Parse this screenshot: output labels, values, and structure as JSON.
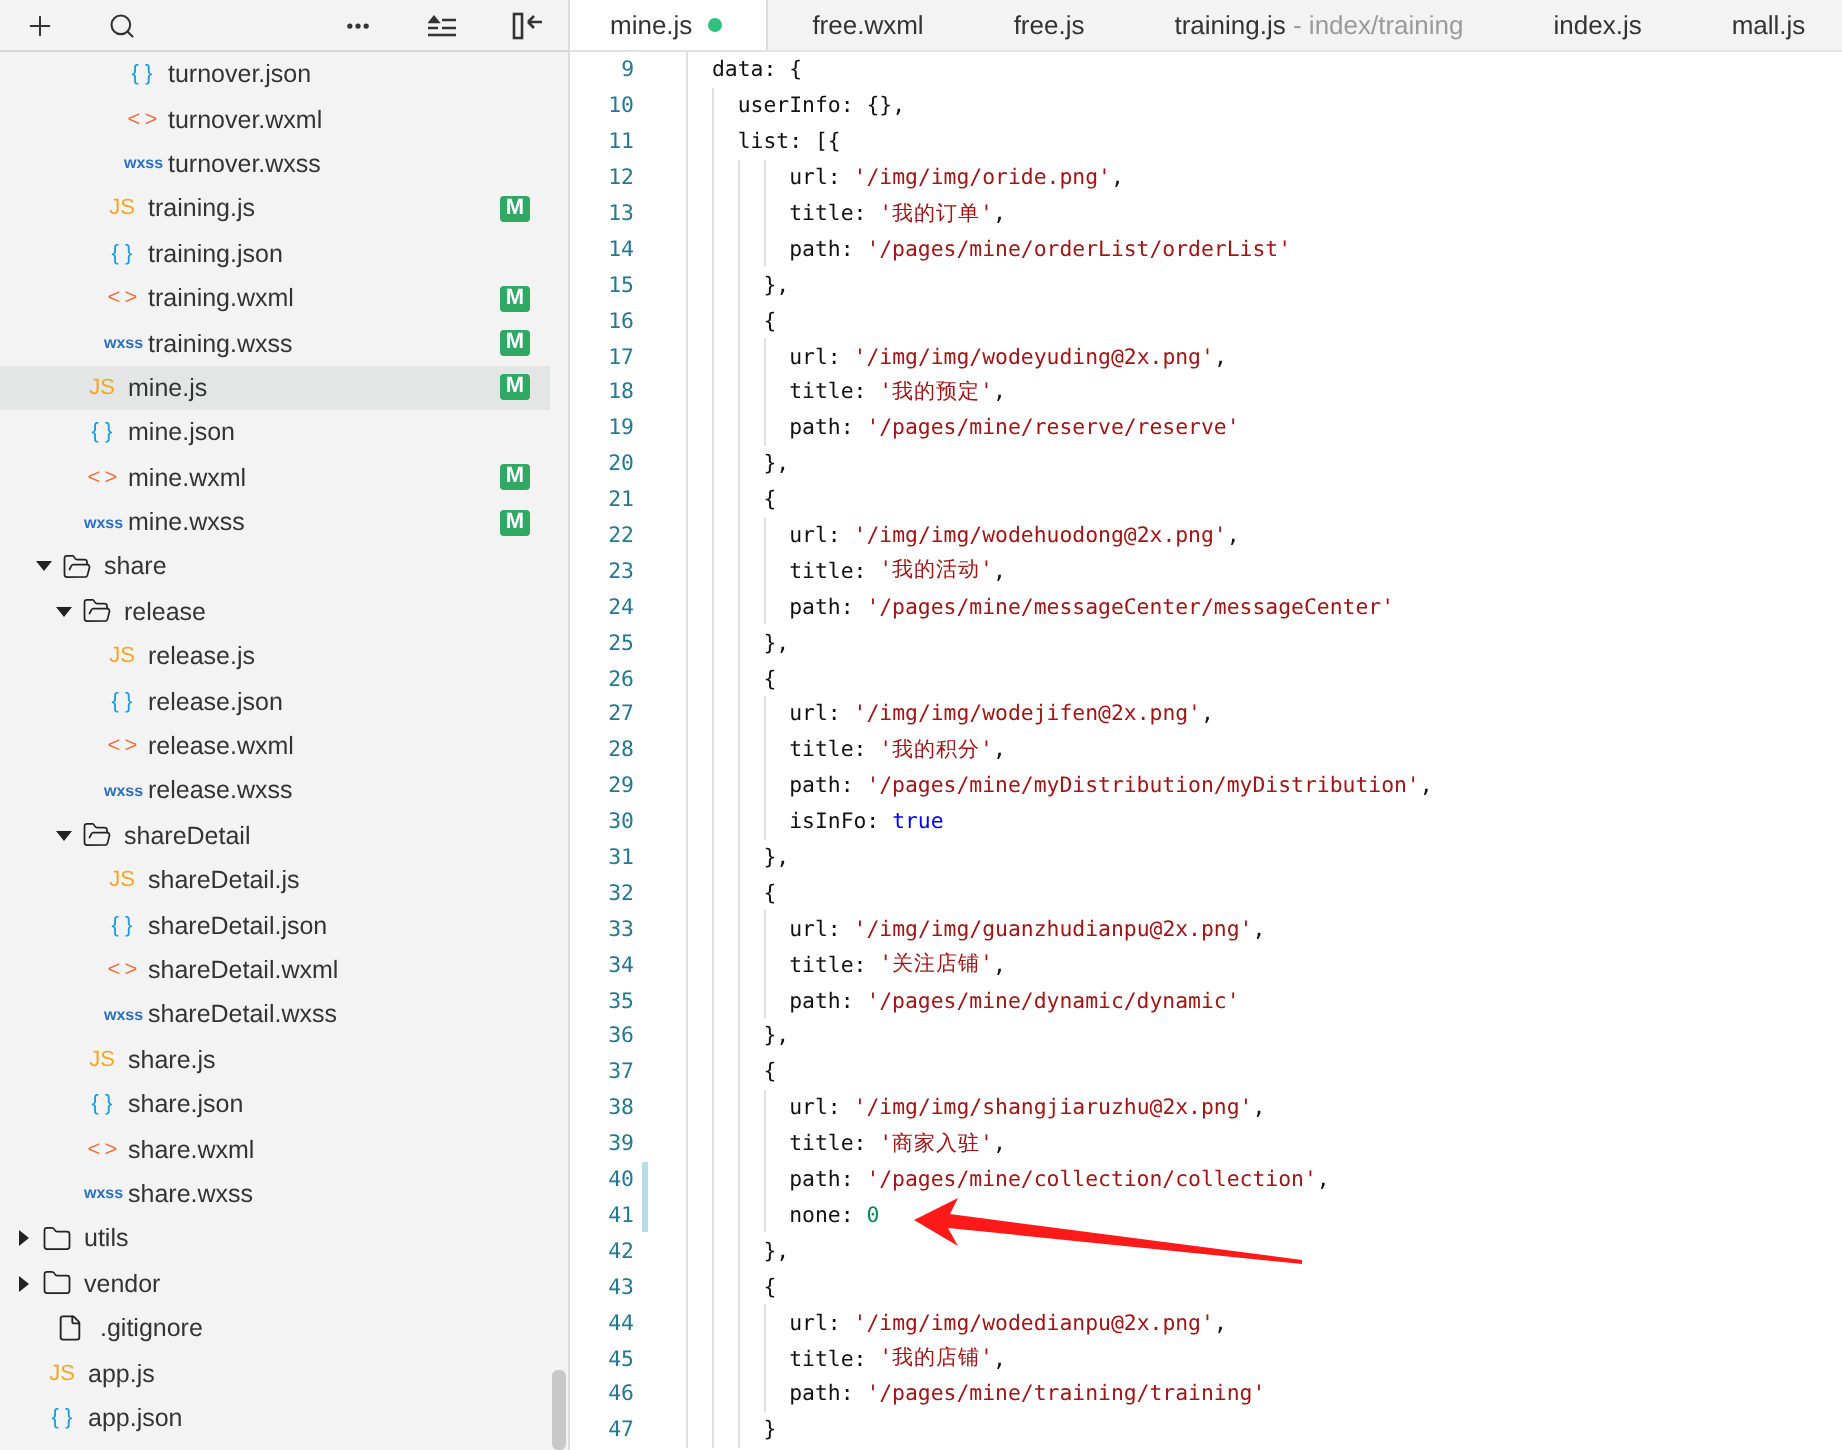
{
  "tree": [
    {
      "children": [
        {
          "children": [
            {
              "children": [
                {
                  "children": [
                    {
                      "label": "turnover.json",
                      "kind": "json",
                      "icon": "{ }",
                      "selected": false
                    },
                    {
                      "label": "turnover.wxml",
                      "kind": "wxml",
                      "icon": "< >",
                      "selected": false
                    },
                    {
                      "label": "turnover.wxss",
                      "kind": "wxss",
                      "icon": "wxss",
                      "selected": false
                    }
                  ]
                },
                {
                  "label": "training.js",
                  "kind": "js",
                  "icon": "JS",
                  "badge": "M",
                  "selected": false
                },
                {
                  "label": "training.json",
                  "kind": "json",
                  "icon": "{ }",
                  "selected": false
                },
                {
                  "label": "training.wxml",
                  "kind": "wxml",
                  "icon": "< >",
                  "badge": "M",
                  "selected": false
                },
                {
                  "label": "training.wxss",
                  "kind": "wxss",
                  "icon": "wxss",
                  "badge": "M",
                  "selected": false
                }
              ]
            },
            {
              "label": "mine.js",
              "kind": "js",
              "icon": "JS",
              "badge": "M",
              "selected": true
            },
            {
              "label": "mine.json",
              "kind": "json",
              "icon": "{ }",
              "selected": false
            },
            {
              "label": "mine.wxml",
              "kind": "wxml",
              "icon": "< >",
              "badge": "M",
              "selected": false
            },
            {
              "label": "mine.wxss",
              "kind": "wxss",
              "icon": "wxss",
              "badge": "M",
              "selected": false
            }
          ]
        },
        {
          "label": "share",
          "kind": "folder",
          "expanded": true,
          "selected": false,
          "children": [
            {
              "label": "release",
              "kind": "folder",
              "expanded": true,
              "selected": false,
              "children": [
                {
                  "label": "release.js",
                  "kind": "js",
                  "icon": "JS",
                  "selected": false
                },
                {
                  "label": "release.json",
                  "kind": "json",
                  "icon": "{ }",
                  "selected": false
                },
                {
                  "label": "release.wxml",
                  "kind": "wxml",
                  "icon": "< >",
                  "selected": false
                },
                {
                  "label": "release.wxss",
                  "kind": "wxss",
                  "icon": "wxss",
                  "selected": false
                }
              ]
            },
            {
              "label": "shareDetail",
              "kind": "folder",
              "expanded": true,
              "selected": false,
              "children": [
                {
                  "label": "shareDetail.js",
                  "kind": "js",
                  "icon": "JS",
                  "selected": false
                },
                {
                  "label": "shareDetail.json",
                  "kind": "json",
                  "icon": "{ }",
                  "selected": false
                },
                {
                  "label": "shareDetail.wxml",
                  "kind": "wxml",
                  "icon": "< >",
                  "selected": false
                },
                {
                  "label": "shareDetail.wxss",
                  "kind": "wxss",
                  "icon": "wxss",
                  "selected": false
                }
              ]
            },
            {
              "label": "share.js",
              "kind": "js",
              "icon": "JS",
              "selected": false
            },
            {
              "label": "share.json",
              "kind": "json",
              "icon": "{ }",
              "selected": false
            },
            {
              "label": "share.wxml",
              "kind": "wxml",
              "icon": "< >",
              "selected": false
            },
            {
              "label": "share.wxss",
              "kind": "wxss",
              "icon": "wxss",
              "selected": false
            }
          ]
        }
      ]
    },
    {
      "label": "utils",
      "kind": "folder",
      "expanded": false,
      "selected": false
    },
    {
      "label": "vendor",
      "kind": "folder",
      "expanded": false,
      "selected": false
    },
    {
      "label": ".gitignore",
      "kind": "file",
      "selected": false
    },
    {
      "label": "app.js",
      "kind": "js",
      "icon": "JS",
      "selected": false
    },
    {
      "label": "app.json",
      "kind": "json",
      "icon": "{ }",
      "selected": false
    }
  ],
  "tabs": [
    {
      "label": "mine.js",
      "selected": true,
      "modified": true
    },
    {
      "label": "free.wxml",
      "selected": false,
      "modified": false
    },
    {
      "label": "free.js",
      "selected": false,
      "modified": false
    },
    {
      "label": "training.js",
      "hint": "- index/training",
      "selected": false,
      "modified": false
    },
    {
      "label": "index.js",
      "selected": false,
      "modified": false
    },
    {
      "label": "mall.js",
      "selected": false,
      "modified": false
    }
  ],
  "lines": [
    {
      "n": "9",
      "changed": false,
      "parts": [
        {
          "kind": "plain",
          "text": "data: {"
        }
      ]
    },
    {
      "n": "10",
      "changed": false,
      "parts": [
        {
          "kind": "plain",
          "text": "  userInfo: {},"
        }
      ]
    },
    {
      "n": "11",
      "changed": false,
      "parts": [
        {
          "kind": "plain",
          "text": "  list: [{"
        }
      ]
    },
    {
      "n": "12",
      "changed": false,
      "parts": [
        {
          "kind": "plain",
          "text": "      url: "
        },
        {
          "kind": "string",
          "text": "'/img/img/oride.png'"
        },
        {
          "kind": "plain",
          "text": ","
        }
      ]
    },
    {
      "n": "13",
      "changed": false,
      "parts": [
        {
          "kind": "plain",
          "text": "      title: "
        },
        {
          "kind": "string",
          "text": "'我的订单'"
        },
        {
          "kind": "plain",
          "text": ","
        }
      ]
    },
    {
      "n": "14",
      "changed": false,
      "parts": [
        {
          "kind": "plain",
          "text": "      path: "
        },
        {
          "kind": "string",
          "text": "'/pages/mine/orderList/orderList'"
        }
      ]
    },
    {
      "n": "15",
      "changed": false,
      "parts": [
        {
          "kind": "plain",
          "text": "    },"
        }
      ]
    },
    {
      "n": "16",
      "changed": false,
      "parts": [
        {
          "kind": "plain",
          "text": "    {"
        }
      ]
    },
    {
      "n": "17",
      "changed": false,
      "parts": [
        {
          "kind": "plain",
          "text": "      url: "
        },
        {
          "kind": "string",
          "text": "'/img/img/wodeyuding@2x.png'"
        },
        {
          "kind": "plain",
          "text": ","
        }
      ]
    },
    {
      "n": "18",
      "changed": false,
      "parts": [
        {
          "kind": "plain",
          "text": "      title: "
        },
        {
          "kind": "string",
          "text": "'我的预定'"
        },
        {
          "kind": "plain",
          "text": ","
        }
      ]
    },
    {
      "n": "19",
      "changed": false,
      "parts": [
        {
          "kind": "plain",
          "text": "      path: "
        },
        {
          "kind": "string",
          "text": "'/pages/mine/reserve/reserve'"
        }
      ]
    },
    {
      "n": "20",
      "changed": false,
      "parts": [
        {
          "kind": "plain",
          "text": "    },"
        }
      ]
    },
    {
      "n": "21",
      "changed": false,
      "parts": [
        {
          "kind": "plain",
          "text": "    {"
        }
      ]
    },
    {
      "n": "22",
      "changed": false,
      "parts": [
        {
          "kind": "plain",
          "text": "      url: "
        },
        {
          "kind": "string",
          "text": "'/img/img/wodehuodong@2x.png'"
        },
        {
          "kind": "plain",
          "text": ","
        }
      ]
    },
    {
      "n": "23",
      "changed": false,
      "parts": [
        {
          "kind": "plain",
          "text": "      title: "
        },
        {
          "kind": "string",
          "text": "'我的活动'"
        },
        {
          "kind": "plain",
          "text": ","
        }
      ]
    },
    {
      "n": "24",
      "changed": false,
      "parts": [
        {
          "kind": "plain",
          "text": "      path: "
        },
        {
          "kind": "string",
          "text": "'/pages/mine/messageCenter/messageCenter'"
        }
      ]
    },
    {
      "n": "25",
      "changed": false,
      "parts": [
        {
          "kind": "plain",
          "text": "    },"
        }
      ]
    },
    {
      "n": "26",
      "changed": false,
      "parts": [
        {
          "kind": "plain",
          "text": "    {"
        }
      ]
    },
    {
      "n": "27",
      "changed": false,
      "parts": [
        {
          "kind": "plain",
          "text": "      url: "
        },
        {
          "kind": "string",
          "text": "'/img/img/wodejifen@2x.png'"
        },
        {
          "kind": "plain",
          "text": ","
        }
      ]
    },
    {
      "n": "28",
      "changed": false,
      "parts": [
        {
          "kind": "plain",
          "text": "      title: "
        },
        {
          "kind": "string",
          "text": "'我的积分'"
        },
        {
          "kind": "plain",
          "text": ","
        }
      ]
    },
    {
      "n": "29",
      "changed": false,
      "parts": [
        {
          "kind": "plain",
          "text": "      path: "
        },
        {
          "kind": "string",
          "text": "'/pages/mine/myDistribution/myDistribution'"
        },
        {
          "kind": "plain",
          "text": ","
        }
      ]
    },
    {
      "n": "30",
      "changed": false,
      "parts": [
        {
          "kind": "plain",
          "text": "      isInFo: "
        },
        {
          "kind": "keyword",
          "text": "true"
        }
      ]
    },
    {
      "n": "31",
      "changed": false,
      "parts": [
        {
          "kind": "plain",
          "text": "    },"
        }
      ]
    },
    {
      "n": "32",
      "changed": false,
      "parts": [
        {
          "kind": "plain",
          "text": "    {"
        }
      ]
    },
    {
      "n": "33",
      "changed": false,
      "parts": [
        {
          "kind": "plain",
          "text": "      url: "
        },
        {
          "kind": "string",
          "text": "'/img/img/guanzhudianpu@2x.png'"
        },
        {
          "kind": "plain",
          "text": ","
        }
      ]
    },
    {
      "n": "34",
      "changed": false,
      "parts": [
        {
          "kind": "plain",
          "text": "      title: "
        },
        {
          "kind": "string",
          "text": "'关注店铺'"
        },
        {
          "kind": "plain",
          "text": ","
        }
      ]
    },
    {
      "n": "35",
      "changed": false,
      "parts": [
        {
          "kind": "plain",
          "text": "      path: "
        },
        {
          "kind": "string",
          "text": "'/pages/mine/dynamic/dynamic'"
        }
      ]
    },
    {
      "n": "36",
      "changed": false,
      "parts": [
        {
          "kind": "plain",
          "text": "    },"
        }
      ]
    },
    {
      "n": "37",
      "changed": false,
      "parts": [
        {
          "kind": "plain",
          "text": "    {"
        }
      ]
    },
    {
      "n": "38",
      "changed": false,
      "parts": [
        {
          "kind": "plain",
          "text": "      url: "
        },
        {
          "kind": "string",
          "text": "'/img/img/shangjiaruzhu@2x.png'"
        },
        {
          "kind": "plain",
          "text": ","
        }
      ]
    },
    {
      "n": "39",
      "changed": false,
      "parts": [
        {
          "kind": "plain",
          "text": "      title: "
        },
        {
          "kind": "string",
          "text": "'商家入驻'"
        },
        {
          "kind": "plain",
          "text": ","
        }
      ]
    },
    {
      "n": "40",
      "changed": true,
      "parts": [
        {
          "kind": "plain",
          "text": "      path: "
        },
        {
          "kind": "string",
          "text": "'/pages/mine/collection/collection'"
        },
        {
          "kind": "plain",
          "text": ","
        }
      ]
    },
    {
      "n": "41",
      "changed": true,
      "parts": [
        {
          "kind": "plain",
          "text": "      none: "
        },
        {
          "kind": "number",
          "text": "0"
        }
      ]
    },
    {
      "n": "42",
      "changed": false,
      "parts": [
        {
          "kind": "plain",
          "text": "    },"
        }
      ]
    },
    {
      "n": "43",
      "changed": false,
      "parts": [
        {
          "kind": "plain",
          "text": "    {"
        }
      ]
    },
    {
      "n": "44",
      "changed": false,
      "parts": [
        {
          "kind": "plain",
          "text": "      url: "
        },
        {
          "kind": "string",
          "text": "'/img/img/wodedianpu@2x.png'"
        },
        {
          "kind": "plain",
          "text": ","
        }
      ]
    },
    {
      "n": "45",
      "changed": false,
      "parts": [
        {
          "kind": "plain",
          "text": "      title: "
        },
        {
          "kind": "string",
          "text": "'我的店铺'"
        },
        {
          "kind": "plain",
          "text": ","
        }
      ]
    },
    {
      "n": "46",
      "changed": false,
      "parts": [
        {
          "kind": "plain",
          "text": "      path: "
        },
        {
          "kind": "string",
          "text": "'/pages/mine/training/training'"
        }
      ]
    },
    {
      "n": "47",
      "changed": false,
      "parts": [
        {
          "kind": "plain",
          "text": "    }"
        }
      ]
    }
  ]
}
